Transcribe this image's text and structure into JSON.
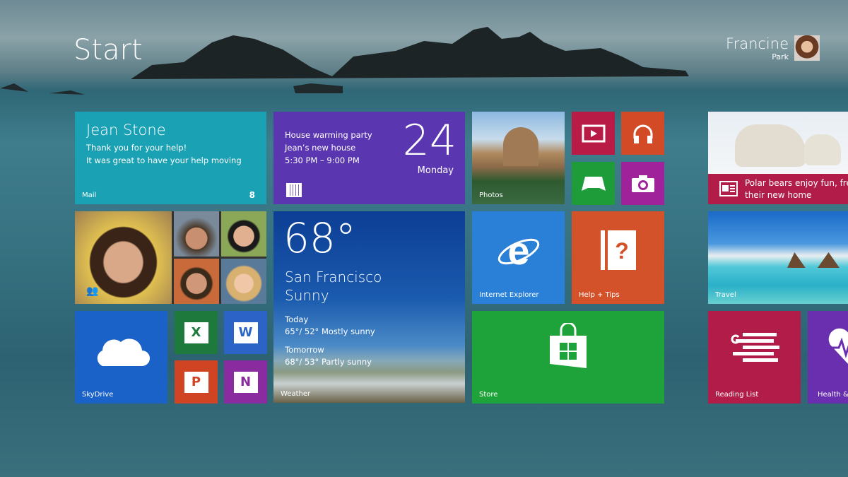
{
  "header": {
    "title": "Start",
    "user_first": "Francine",
    "user_last": "Park"
  },
  "tiles": {
    "mail": {
      "sender": "Jean Stone",
      "line1": "Thank you for your help!",
      "line2": "It was great to have your help moving",
      "label": "Mail",
      "count": "8",
      "color": "#1ba1b4"
    },
    "calendar": {
      "event": "House warming party",
      "location": "Jean’s new house",
      "time": "5:30 PM – 9:00 PM",
      "day_number": "24",
      "weekday": "Monday",
      "color": "#5a37b0"
    },
    "photos": {
      "label": "Photos"
    },
    "video": {
      "color": "#b81b45"
    },
    "music": {
      "color": "#d24a26"
    },
    "games": {
      "color": "#1e9c3a"
    },
    "camera": {
      "color": "#a0229a"
    },
    "people": {},
    "weather": {
      "temp": "68°",
      "city": "San Francisco",
      "condition": "Sunny",
      "today_label": "Today",
      "today_forecast": "65°/ 52° Mostly sunny",
      "tomorrow_label": "Tomorrow",
      "tomorrow_forecast": "68°/ 53° Partly sunny",
      "label": "Weather"
    },
    "ie": {
      "label": "Internet Explorer",
      "color": "#2a7fd6"
    },
    "help": {
      "label": "Help + Tips",
      "color": "#d4522a"
    },
    "skydrive": {
      "label": "SkyDrive",
      "color": "#1a62c8"
    },
    "excel": {
      "letter": "X",
      "color": "#1e7a3c"
    },
    "word": {
      "letter": "W",
      "color": "#2b63c6"
    },
    "powerpoint": {
      "letter": "P",
      "color": "#d04424"
    },
    "onenote": {
      "letter": "N",
      "color": "#8a2ba0"
    },
    "store": {
      "label": "Store",
      "color": "#1ea23a"
    },
    "news": {
      "headline": "Polar bears enjoy fun, freedom in their new home",
      "line1": "Polar bears enjoy fun, free",
      "line2": "their new home",
      "color": "#b11d48"
    },
    "travel": {
      "label": "Travel"
    },
    "reading_list": {
      "label": "Reading List",
      "color": "#b11d48"
    },
    "health": {
      "label": "Health &",
      "color": "#6a2fae"
    }
  }
}
